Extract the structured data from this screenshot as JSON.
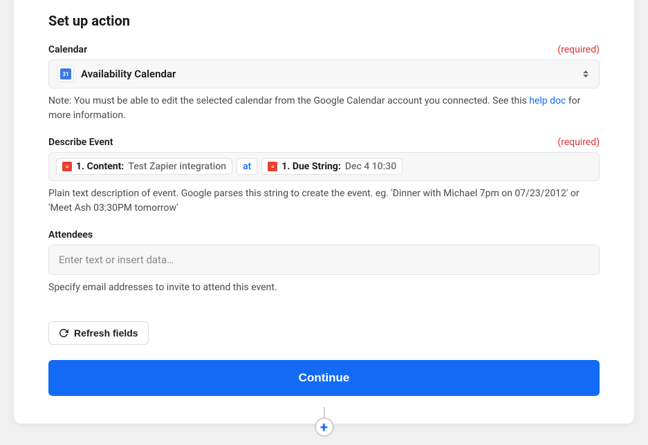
{
  "section_title": "Set up action",
  "fields": {
    "calendar": {
      "label": "Calendar",
      "required_text": "(required)",
      "value": "Availability Calendar",
      "icon_text": "31",
      "note_prefix": "Note: You must be able to edit the selected calendar from the Google Calendar account you connected. See this ",
      "note_link": "help doc",
      "note_suffix": " for more information."
    },
    "describe_event": {
      "label": "Describe Event",
      "required_text": "(required)",
      "pills": [
        {
          "label": "1. Content:",
          "value": "Test Zapier integration"
        },
        {
          "label": "1. Due String:",
          "value": "Dec 4 10:30"
        }
      ],
      "separator": "at",
      "help": "Plain text description of event. Google parses this string to create the event. eg. 'Dinner with Michael 7pm on 07/23/2012' or 'Meet Ash 03:30PM tomorrow'"
    },
    "attendees": {
      "label": "Attendees",
      "placeholder": "Enter text or insert data…",
      "help": "Specify email addresses to invite to attend this event."
    }
  },
  "refresh_label": "Refresh fields",
  "continue_label": "Continue",
  "todoist_glyph": "≡"
}
